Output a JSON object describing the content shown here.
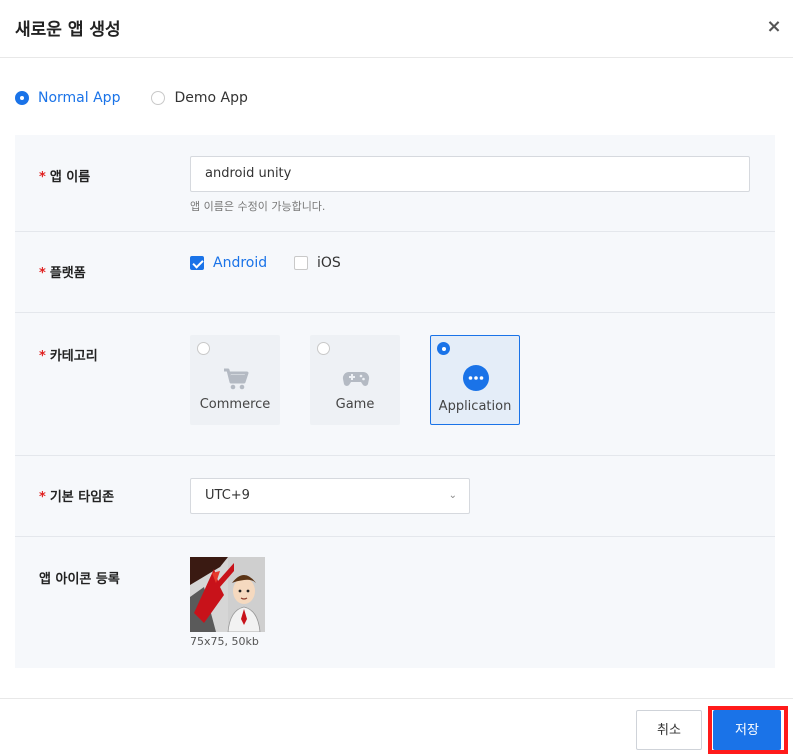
{
  "dialog": {
    "title": "새로운 앱 생성",
    "close_symbol": "×"
  },
  "app_types": [
    {
      "label": "Normal App",
      "selected": true
    },
    {
      "label": "Demo App",
      "selected": false
    }
  ],
  "form": {
    "app_name": {
      "label": "앱 이름",
      "required_mark": "*",
      "value": "android unity",
      "help": "앱 이름은 수정이 가능합니다."
    },
    "platform": {
      "label": "플랫폼",
      "required_mark": "*",
      "options": [
        {
          "label": "Android",
          "checked": true
        },
        {
          "label": "iOS",
          "checked": false
        }
      ]
    },
    "category": {
      "label": "카테고리",
      "required_mark": "*",
      "options": [
        {
          "label": "Commerce",
          "icon": "cart-icon",
          "selected": false
        },
        {
          "label": "Game",
          "icon": "gamepad-icon",
          "selected": false
        },
        {
          "label": "Application",
          "icon": "more-dots-icon",
          "selected": true
        }
      ]
    },
    "timezone": {
      "label": "기본 타임존",
      "required_mark": "*",
      "value": "UTC+9",
      "chevron": "⌄"
    },
    "app_icon": {
      "label": "앱 아이콘 등록",
      "size_hint": "75x75, 50kb",
      "image": "app-icon-image"
    }
  },
  "footer": {
    "cancel_label": "취소",
    "save_label": "저장"
  },
  "colors": {
    "accent": "#1a73e8",
    "required": "#e02020",
    "highlight": "#ff1a1a",
    "form_bg": "#f6f8fb"
  }
}
